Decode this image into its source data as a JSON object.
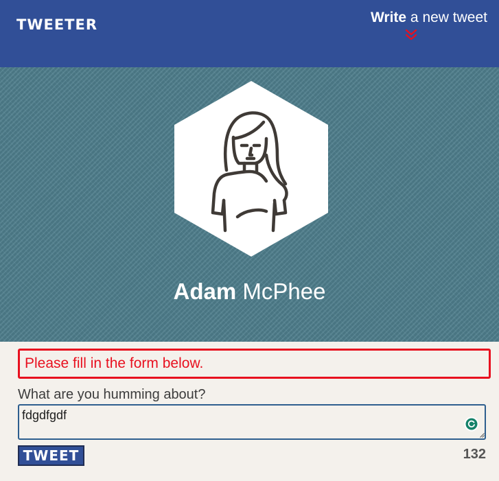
{
  "app": {
    "brand": "TWEETER"
  },
  "header": {
    "write_bold": "Write",
    "write_rest": " a new tweet",
    "icon": "double-chevron-down-icon"
  },
  "profile": {
    "first_name": "Adam",
    "last_name": "McPhee",
    "avatar_icon": "person-avatar-icon"
  },
  "form": {
    "alert_text": "Please fill in the form below.",
    "prompt_label": "What are you humming about?",
    "input_value": "fdgdfgdf",
    "submit_label": "TWEET",
    "remaining_chars": "132"
  },
  "colors": {
    "header_bg": "#314f97",
    "hero_bg": "#4f7f8d",
    "alert": "#e8101f",
    "accent_red": "#e8101f",
    "page_bg": "#f4f1ec"
  }
}
